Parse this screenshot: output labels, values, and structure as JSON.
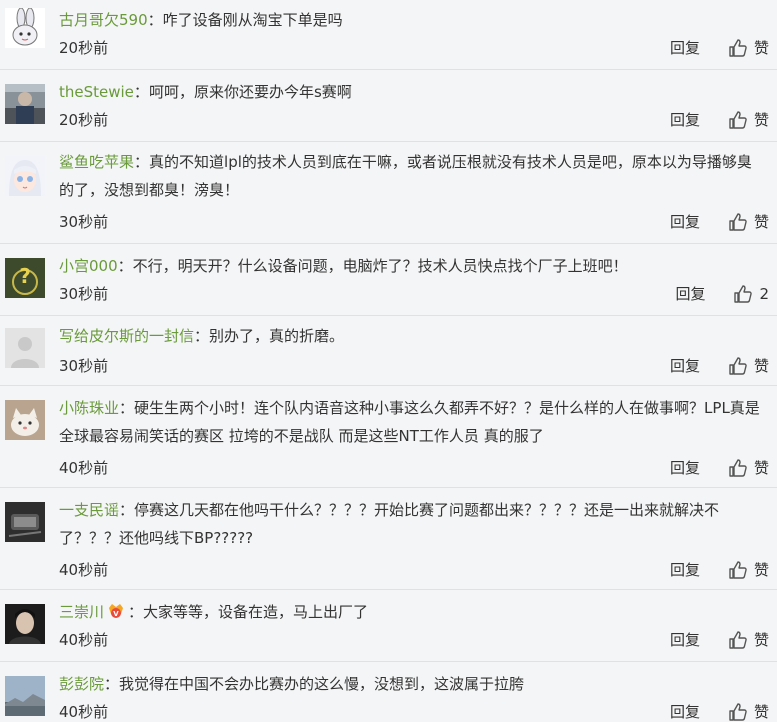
{
  "reply_label": "回复",
  "like_label": "赞",
  "colon": "：",
  "comments": [
    {
      "name": "古月哥欠590",
      "text": "咋了设备刚从淘宝下单是吗",
      "time": "20秒前",
      "likes": "赞",
      "avatar": "rabbit-avatar"
    },
    {
      "name": "theStewie",
      "text": "呵呵，原来你还要办今年s赛啊",
      "time": "20秒前",
      "likes": "赞",
      "avatar": "photo-avatar"
    },
    {
      "name": "鲨鱼吃苹果",
      "text": "真的不知道lpl的技术人员到底在干嘛，或者说压根就没有技术人员是吧，原本以为导播够臭的了，没想到都臭！滂臭！",
      "time": "30秒前",
      "likes": "赞",
      "avatar": "anime-avatar"
    },
    {
      "name": "小宫000",
      "text": "不行，明天开？什么设备问题，电脑炸了？技术人员快点找个厂子上班吧！",
      "time": "30秒前",
      "likes": "2",
      "avatar": "question-avatar"
    },
    {
      "name": "写给皮尔斯的一封信",
      "text": "别办了，真的折磨。",
      "time": "30秒前",
      "likes": "赞",
      "avatar": "default-avatar"
    },
    {
      "name": "小陈珠业",
      "text": "硬生生两个小时！连个队内语音这种小事这么久都弄不好？？是什么样的人在做事啊？LPL真是全球最容易闹笑话的赛区 拉垮的不是战队 而是这些NT工作人员 真的服了",
      "time": "40秒前",
      "likes": "赞",
      "avatar": "cat-avatar"
    },
    {
      "name": "一支民谣",
      "text": "停赛这几天都在他吗干什么？？？？开始比赛了问题都出来？？？？还是一出来就解决不了？？？还他吗线下BP?????",
      "time": "40秒前",
      "likes": "赞",
      "avatar": "dark-avatar"
    },
    {
      "name": "三崇川",
      "text": "大家等等，设备在造，马上出厂了",
      "time": "40秒前",
      "likes": "赞",
      "avatar": "man-avatar"
    },
    {
      "name": "彭彭院",
      "text": "我觉得在中国不会办比赛办的这么慢，没想到，这波属于拉胯",
      "time": "40秒前",
      "likes": "赞",
      "avatar": "sky-avatar"
    }
  ]
}
